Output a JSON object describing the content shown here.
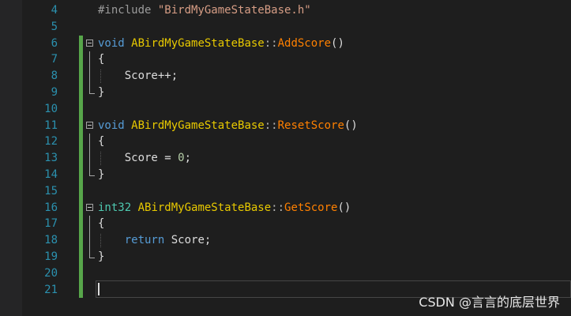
{
  "editor": {
    "lines": [
      {
        "num": "4",
        "tokens": [
          {
            "t": "#include ",
            "c": "pre"
          },
          {
            "t": "\"BirdMyGameStateBase.h\"",
            "c": "str"
          }
        ]
      },
      {
        "num": "5",
        "tokens": []
      },
      {
        "num": "6",
        "tokens": [
          {
            "t": "void",
            "c": "kw"
          },
          {
            "t": " ",
            "c": "plain"
          },
          {
            "t": "ABirdMyGameStateBase",
            "c": "cls"
          },
          {
            "t": "::",
            "c": "op"
          },
          {
            "t": "AddScore",
            "c": "fn"
          },
          {
            "t": "()",
            "c": "plain"
          }
        ]
      },
      {
        "num": "7",
        "tokens": [
          {
            "t": "{",
            "c": "plain"
          }
        ]
      },
      {
        "num": "8",
        "tokens": [
          {
            "t": "    Score++;",
            "c": "plain"
          }
        ]
      },
      {
        "num": "9",
        "tokens": [
          {
            "t": "}",
            "c": "plain"
          }
        ]
      },
      {
        "num": "10",
        "tokens": []
      },
      {
        "num": "11",
        "tokens": [
          {
            "t": "void",
            "c": "kw"
          },
          {
            "t": " ",
            "c": "plain"
          },
          {
            "t": "ABirdMyGameStateBase",
            "c": "cls"
          },
          {
            "t": "::",
            "c": "op"
          },
          {
            "t": "ResetScore",
            "c": "fn"
          },
          {
            "t": "()",
            "c": "plain"
          }
        ]
      },
      {
        "num": "12",
        "tokens": [
          {
            "t": "{",
            "c": "plain"
          }
        ]
      },
      {
        "num": "13",
        "tokens": [
          {
            "t": "    Score = ",
            "c": "plain"
          },
          {
            "t": "0",
            "c": "num"
          },
          {
            "t": ";",
            "c": "plain"
          }
        ]
      },
      {
        "num": "14",
        "tokens": [
          {
            "t": "}",
            "c": "plain"
          }
        ]
      },
      {
        "num": "15",
        "tokens": []
      },
      {
        "num": "16",
        "tokens": [
          {
            "t": "int32",
            "c": "type"
          },
          {
            "t": " ",
            "c": "plain"
          },
          {
            "t": "ABirdMyGameStateBase",
            "c": "cls"
          },
          {
            "t": "::",
            "c": "op"
          },
          {
            "t": "GetScore",
            "c": "fn"
          },
          {
            "t": "()",
            "c": "plain"
          }
        ]
      },
      {
        "num": "17",
        "tokens": [
          {
            "t": "{",
            "c": "plain"
          }
        ]
      },
      {
        "num": "18",
        "tokens": [
          {
            "t": "    ",
            "c": "plain"
          },
          {
            "t": "return",
            "c": "kw"
          },
          {
            "t": " Score;",
            "c": "plain"
          }
        ]
      },
      {
        "num": "19",
        "tokens": [
          {
            "t": "}",
            "c": "plain"
          }
        ]
      },
      {
        "num": "20",
        "tokens": []
      },
      {
        "num": "21",
        "tokens": []
      }
    ],
    "colors": {
      "background": "#1e1e1e",
      "line_number": "#2b91af",
      "change_bar": "#57a64a",
      "keyword": "#569cd6",
      "class_name": "#e8c900",
      "function_name": "#ff8000",
      "string": "#d69d85"
    }
  },
  "watermark": "CSDN @言言的底层世界"
}
